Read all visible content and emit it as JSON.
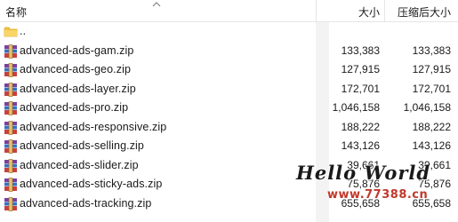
{
  "header": {
    "name": "名称",
    "size": "大小",
    "packed_size": "压缩后大小"
  },
  "parent_folder": {
    "label": "..",
    "icon": "folder-icon"
  },
  "files": [
    {
      "name": "advanced-ads-gam.zip",
      "size": "133,383",
      "packed_size": "133,383",
      "icon": "winrar-archive-icon"
    },
    {
      "name": "advanced-ads-geo.zip",
      "size": "127,915",
      "packed_size": "127,915",
      "icon": "winrar-archive-icon"
    },
    {
      "name": "advanced-ads-layer.zip",
      "size": "172,701",
      "packed_size": "172,701",
      "icon": "winrar-archive-icon"
    },
    {
      "name": "advanced-ads-pro.zip",
      "size": "1,046,158",
      "packed_size": "1,046,158",
      "icon": "winrar-archive-icon"
    },
    {
      "name": "advanced-ads-responsive.zip",
      "size": "188,222",
      "packed_size": "188,222",
      "icon": "winrar-archive-icon"
    },
    {
      "name": "advanced-ads-selling.zip",
      "size": "143,126",
      "packed_size": "143,126",
      "icon": "winrar-archive-icon"
    },
    {
      "name": "advanced-ads-slider.zip",
      "size": "39,661",
      "packed_size": "39,661",
      "icon": "winrar-archive-icon"
    },
    {
      "name": "advanced-ads-sticky-ads.zip",
      "size": "75,876",
      "packed_size": "75,876",
      "icon": "winrar-archive-icon"
    },
    {
      "name": "advanced-ads-tracking.zip",
      "size": "655,658",
      "packed_size": "655,658",
      "icon": "winrar-archive-icon"
    }
  ],
  "watermark": {
    "title": "Hello World",
    "url": "www.77388.cn"
  },
  "colors": {
    "archive_purple": "#7b3fa0",
    "archive_blue": "#3a6fc4",
    "archive_red": "#c94040",
    "folder_yellow": "#f5c542",
    "watermark_red": "#c0392b"
  }
}
